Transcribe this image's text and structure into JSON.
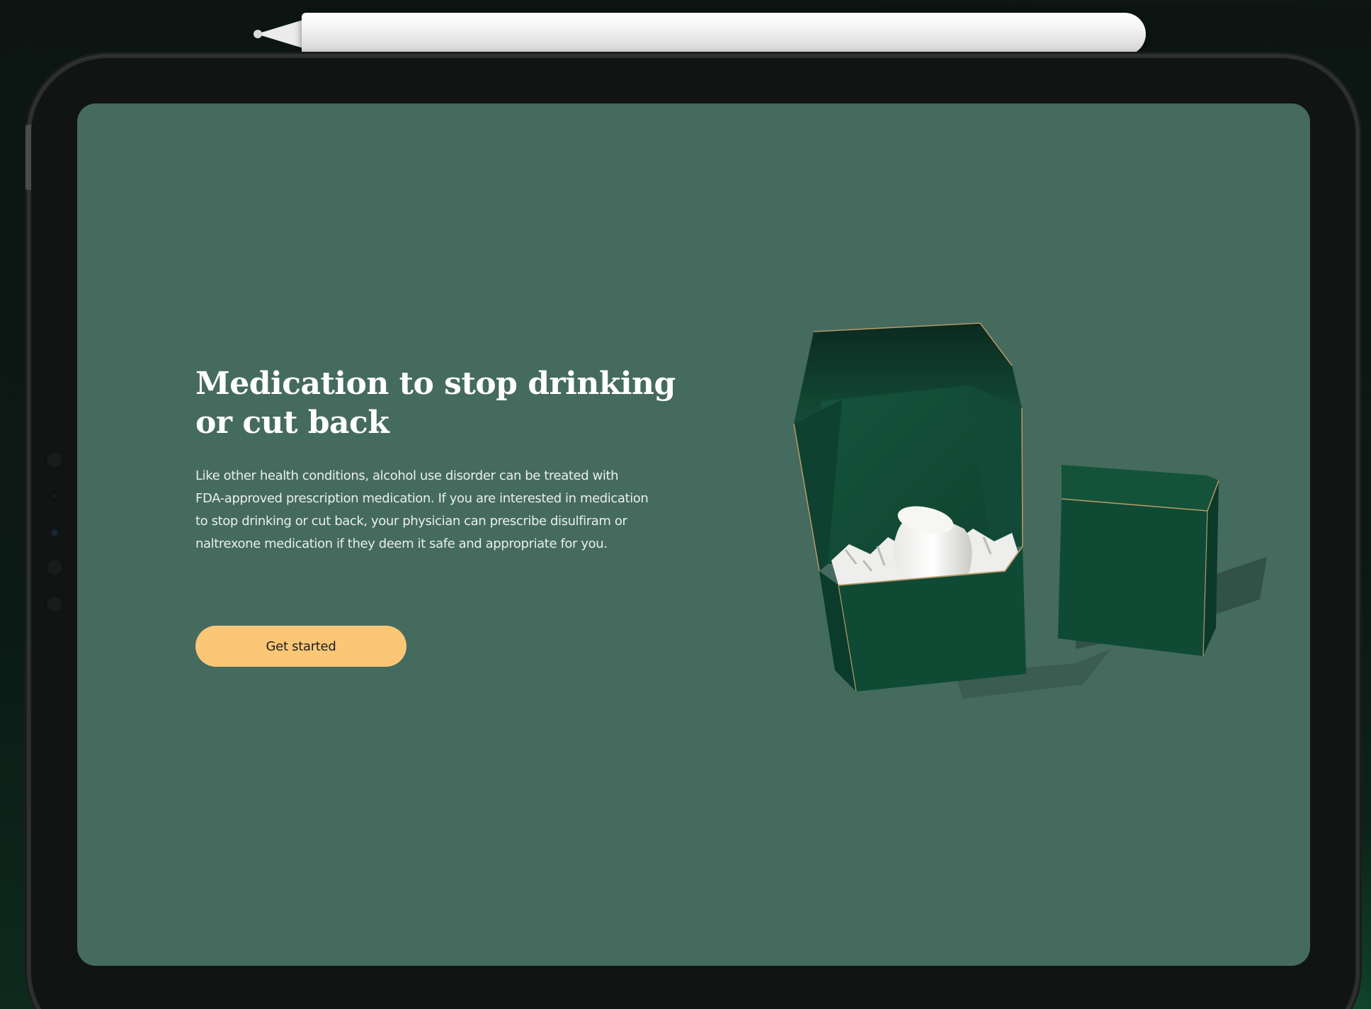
{
  "hero": {
    "headline": "Medication to stop drinking or cut back",
    "body": "Like other health conditions, alcohol use disorder can be treated with FDA-approved prescription medication. If you are interested in medication to stop drinking or cut back, your physician can prescribe disulfiram or naltrexone medication if they deem it safe and appropriate for you.",
    "cta_label": "Get started"
  },
  "colors": {
    "screen_background": "#456a5e",
    "cta_background": "#fbc777",
    "box_green": "#0f4a35",
    "tablet_frame": "#121313"
  },
  "icons": {
    "product": "medication-box-with-pill-bottle"
  }
}
